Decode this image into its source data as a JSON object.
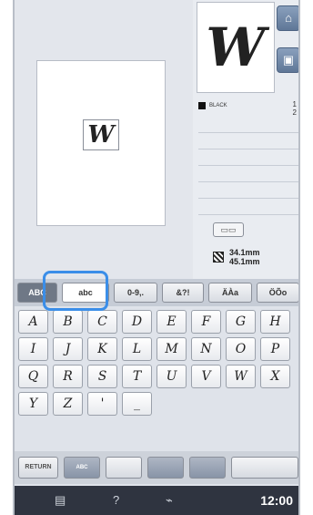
{
  "preview": {
    "letter": "W"
  },
  "info": {
    "big_letter": "W",
    "home_icon": "home-icon",
    "memory_icon": "memory-icon",
    "color_name": "BLACK",
    "stitch_label": "1",
    "stitch_value": "2",
    "width": "34.1mm",
    "height": "45.1mm"
  },
  "tabs": [
    {
      "label": "ABC",
      "type": "font"
    },
    {
      "label": "abc",
      "type": "active"
    },
    {
      "label": "0-9,.",
      "type": "normal"
    },
    {
      "label": "&?!",
      "type": "normal"
    },
    {
      "label": "ÄÀa",
      "type": "normal"
    },
    {
      "label": "ÖÕo",
      "type": "normal"
    }
  ],
  "keys": [
    [
      "A",
      "B",
      "C",
      "D",
      "E",
      "F",
      "G",
      "H"
    ],
    [
      "I",
      "J",
      "K",
      "L",
      "M",
      "N",
      "O",
      "P"
    ],
    [
      "Q",
      "R",
      "S",
      "T",
      "U",
      "V",
      "W",
      "X"
    ],
    [
      "Y",
      "Z",
      "'",
      "_"
    ]
  ],
  "toolbar": {
    "return_label": "RETURN",
    "btn2": "ABC",
    "btn3": "",
    "btn4": "",
    "btn5": "",
    "btn6": ""
  },
  "status": {
    "time": "12:00",
    "help": "?"
  }
}
